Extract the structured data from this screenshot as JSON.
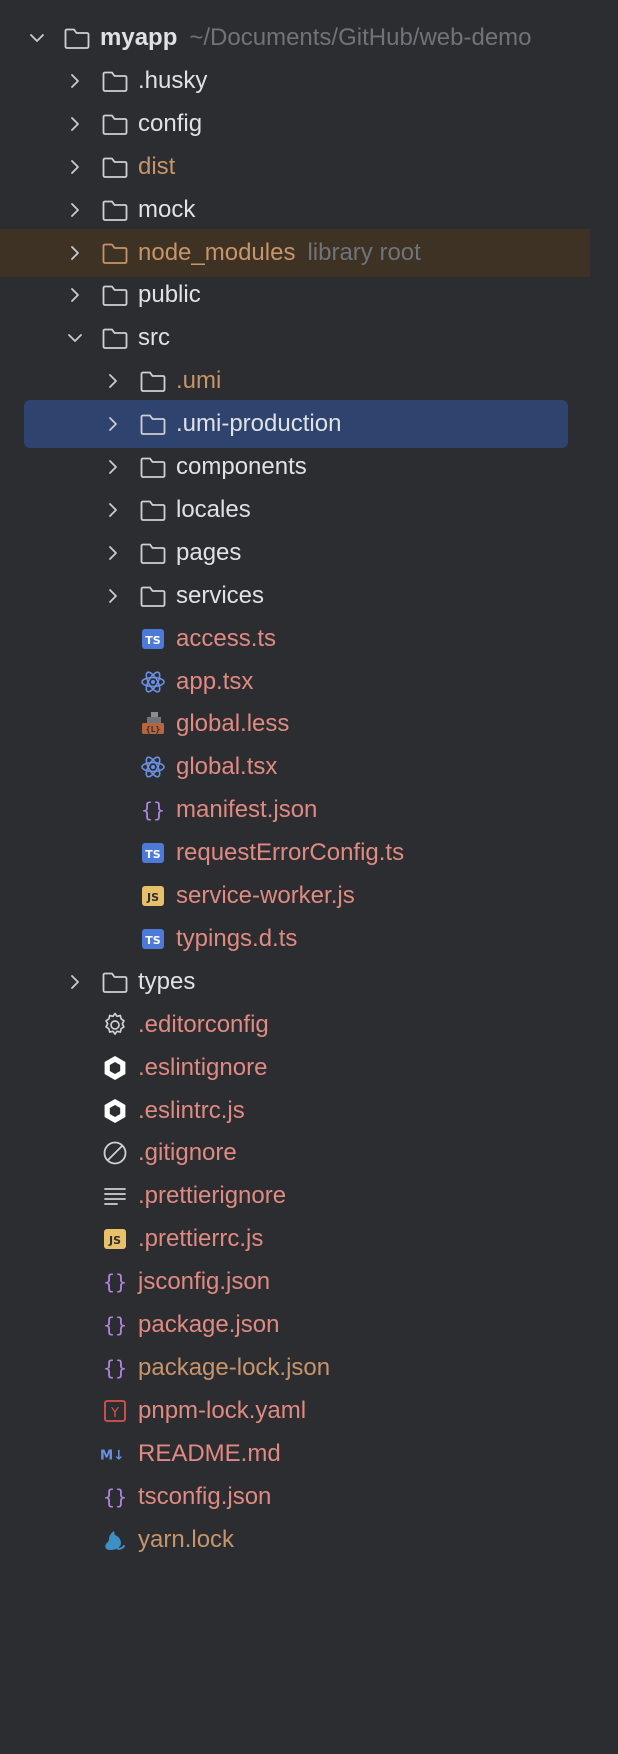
{
  "colors": {
    "background": "#2b2d30",
    "selection": "#2e436e",
    "excluded_bg": "#3d3223",
    "default_text": "#dfe1e5",
    "modified_text": "#e08a82",
    "excluded_text": "#c8946a",
    "hint_text": "#6f737a"
  },
  "root": {
    "name": "myapp",
    "path": "~/Documents/GitHub/web-demo"
  },
  "items": [
    {
      "name": ".husky",
      "depth": 1,
      "type": "folder",
      "icon": "folder-icon",
      "expandable": true,
      "expanded": false,
      "color": "#dfe1e5"
    },
    {
      "name": "config",
      "depth": 1,
      "type": "folder",
      "icon": "folder-icon",
      "expandable": true,
      "expanded": false,
      "color": "#dfe1e5"
    },
    {
      "name": "dist",
      "depth": 1,
      "type": "folder",
      "icon": "folder-icon",
      "expandable": true,
      "expanded": false,
      "color": "#c8946a"
    },
    {
      "name": "mock",
      "depth": 1,
      "type": "folder",
      "icon": "folder-icon",
      "expandable": true,
      "expanded": false,
      "color": "#dfe1e5"
    },
    {
      "name": "node_modules",
      "hint": "library root",
      "depth": 1,
      "type": "folder",
      "icon": "folder-icon",
      "expandable": true,
      "expanded": false,
      "color": "#c8946a",
      "excluded": true
    },
    {
      "name": "public",
      "depth": 1,
      "type": "folder",
      "icon": "folder-icon",
      "expandable": true,
      "expanded": false,
      "color": "#dfe1e5"
    },
    {
      "name": "src",
      "depth": 1,
      "type": "folder",
      "icon": "folder-icon",
      "expandable": true,
      "expanded": true,
      "color": "#dfe1e5"
    },
    {
      "name": ".umi",
      "depth": 2,
      "type": "folder",
      "icon": "folder-icon",
      "expandable": true,
      "expanded": false,
      "color": "#c8946a"
    },
    {
      "name": ".umi-production",
      "depth": 2,
      "type": "folder",
      "icon": "folder-icon",
      "expandable": true,
      "expanded": false,
      "color": "#dfe1e5",
      "selected": true
    },
    {
      "name": "components",
      "depth": 2,
      "type": "folder",
      "icon": "folder-icon",
      "expandable": true,
      "expanded": false,
      "color": "#dfe1e5"
    },
    {
      "name": "locales",
      "depth": 2,
      "type": "folder",
      "icon": "folder-icon",
      "expandable": true,
      "expanded": false,
      "color": "#dfe1e5"
    },
    {
      "name": "pages",
      "depth": 2,
      "type": "folder",
      "icon": "folder-icon",
      "expandable": true,
      "expanded": false,
      "color": "#dfe1e5"
    },
    {
      "name": "services",
      "depth": 2,
      "type": "folder",
      "icon": "folder-icon",
      "expandable": true,
      "expanded": false,
      "color": "#dfe1e5"
    },
    {
      "name": "access.ts",
      "depth": 2,
      "type": "file",
      "icon": "typescript-icon",
      "color": "#e08a82"
    },
    {
      "name": "app.tsx",
      "depth": 2,
      "type": "file",
      "icon": "react-icon",
      "color": "#e08a82"
    },
    {
      "name": "global.less",
      "depth": 2,
      "type": "file",
      "icon": "less-icon",
      "color": "#e08a82"
    },
    {
      "name": "global.tsx",
      "depth": 2,
      "type": "file",
      "icon": "react-icon",
      "color": "#e08a82"
    },
    {
      "name": "manifest.json",
      "depth": 2,
      "type": "file",
      "icon": "json-icon",
      "color": "#e08a82"
    },
    {
      "name": "requestErrorConfig.ts",
      "depth": 2,
      "type": "file",
      "icon": "typescript-icon",
      "color": "#e08a82"
    },
    {
      "name": "service-worker.js",
      "depth": 2,
      "type": "file",
      "icon": "javascript-icon",
      "color": "#e08a82"
    },
    {
      "name": "typings.d.ts",
      "depth": 2,
      "type": "file",
      "icon": "typescript-icon",
      "color": "#e08a82"
    },
    {
      "name": "types",
      "depth": 1,
      "type": "folder",
      "icon": "folder-icon",
      "expandable": true,
      "expanded": false,
      "color": "#dfe1e5"
    },
    {
      "name": ".editorconfig",
      "depth": 1,
      "type": "file",
      "icon": "gear-icon",
      "color": "#e08a82"
    },
    {
      "name": ".eslintignore",
      "depth": 1,
      "type": "file",
      "icon": "eslint-icon",
      "color": "#e08a82"
    },
    {
      "name": ".eslintrc.js",
      "depth": 1,
      "type": "file",
      "icon": "eslint-icon",
      "color": "#e08a82"
    },
    {
      "name": ".gitignore",
      "depth": 1,
      "type": "file",
      "icon": "ignore-icon",
      "color": "#e08a82"
    },
    {
      "name": ".prettierignore",
      "depth": 1,
      "type": "file",
      "icon": "text-lines-icon",
      "color": "#e08a82"
    },
    {
      "name": ".prettierrc.js",
      "depth": 1,
      "type": "file",
      "icon": "javascript-icon",
      "color": "#e08a82"
    },
    {
      "name": "jsconfig.json",
      "depth": 1,
      "type": "file",
      "icon": "json-icon",
      "color": "#e08a82"
    },
    {
      "name": "package.json",
      "depth": 1,
      "type": "file",
      "icon": "json-icon",
      "color": "#e08a82"
    },
    {
      "name": "package-lock.json",
      "depth": 1,
      "type": "file",
      "icon": "json-icon",
      "color": "#c8946a"
    },
    {
      "name": "pnpm-lock.yaml",
      "depth": 1,
      "type": "file",
      "icon": "yaml-icon",
      "color": "#e08a82"
    },
    {
      "name": "README.md",
      "depth": 1,
      "type": "file",
      "icon": "markdown-icon",
      "color": "#e08a82"
    },
    {
      "name": "tsconfig.json",
      "depth": 1,
      "type": "file",
      "icon": "json-icon",
      "color": "#e08a82"
    },
    {
      "name": "yarn.lock",
      "depth": 1,
      "type": "file",
      "icon": "yarn-icon",
      "color": "#c8946a"
    }
  ]
}
